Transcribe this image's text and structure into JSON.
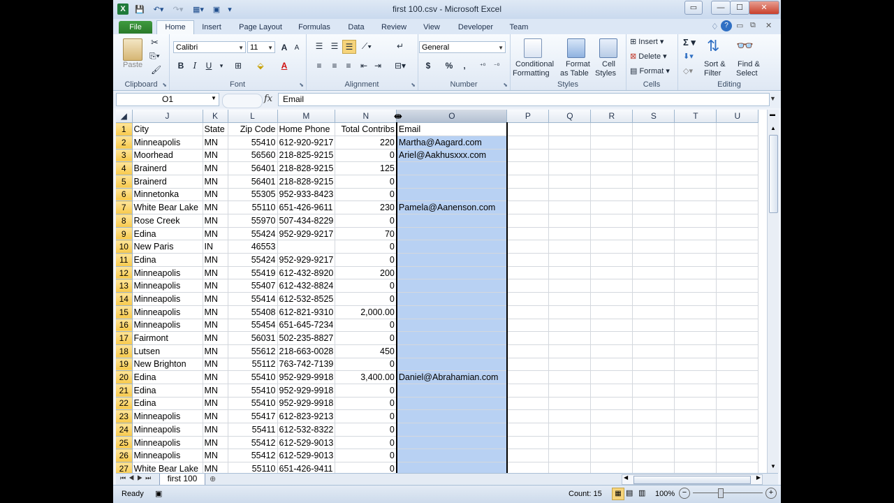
{
  "window": {
    "title": "first 100.csv  -  Microsoft Excel",
    "help_icon": "?",
    "qat": {
      "save": "save-icon",
      "undo": "undo-icon",
      "redo": "redo-icon",
      "customize": "customize-qat-icon"
    }
  },
  "tabs": [
    "File",
    "Home",
    "Insert",
    "Page Layout",
    "Formulas",
    "Data",
    "Review",
    "View",
    "Developer",
    "Team"
  ],
  "ribbon": {
    "clipboard": {
      "label": "Clipboard",
      "paste": "Paste"
    },
    "font": {
      "label": "Font",
      "name": "Calibri",
      "size": "11",
      "bold": "B",
      "italic": "I",
      "underline": "U",
      "grow": "A",
      "shrink": "A"
    },
    "alignment": {
      "label": "Alignment"
    },
    "number": {
      "label": "Number",
      "format": "General",
      "currency": "$",
      "percent": "%",
      "comma": ","
    },
    "styles": {
      "label": "Styles",
      "conditional": "Conditional",
      "conditional2": "Formatting",
      "format_table": "Format",
      "format_table2": "as Table",
      "cell_styles": "Cell",
      "cell_styles2": "Styles"
    },
    "cells": {
      "label": "Cells",
      "insert": "Insert",
      "delete": "Delete",
      "format": "Format"
    },
    "editing": {
      "label": "Editing",
      "sort": "Sort &",
      "sort2": "Filter",
      "find": "Find &",
      "find2": "Select",
      "sum": "Σ"
    }
  },
  "formula_bar": {
    "name_box": "O1",
    "fx": "fx",
    "content": "Email"
  },
  "grid": {
    "columns": [
      "J",
      "K",
      "L",
      "M",
      "N",
      "O",
      "P",
      "Q",
      "R",
      "S",
      "T",
      "U"
    ],
    "rows": [
      {
        "n": "1",
        "city": "City",
        "state": "State",
        "zip": "Zip Code",
        "phone": "Home Phone",
        "contrib": "Total Contribs",
        "email": "Email"
      },
      {
        "n": "2",
        "city": "Minneapolis",
        "state": "MN",
        "zip": "55410",
        "phone": "612-920-9217",
        "contrib": "220",
        "email": "Martha@Aagard.com"
      },
      {
        "n": "3",
        "city": "Moorhead",
        "state": "MN",
        "zip": "56560",
        "phone": "218-825-9215",
        "contrib": "0",
        "email": "Ariel@Aakhusxxx.com"
      },
      {
        "n": "4",
        "city": "Brainerd",
        "state": "MN",
        "zip": "56401",
        "phone": "218-828-9215",
        "contrib": "125",
        "email": ""
      },
      {
        "n": "5",
        "city": "Brainerd",
        "state": "MN",
        "zip": "56401",
        "phone": "218-828-9215",
        "contrib": "0",
        "email": ""
      },
      {
        "n": "6",
        "city": "Minnetonka",
        "state": "MN",
        "zip": "55305",
        "phone": "952-933-8423",
        "contrib": "0",
        "email": ""
      },
      {
        "n": "7",
        "city": "White Bear Lake",
        "state": "MN",
        "zip": "55110",
        "phone": "651-426-9611",
        "contrib": "230",
        "email": "Pamela@Aanenson.com"
      },
      {
        "n": "8",
        "city": "Rose Creek",
        "state": "MN",
        "zip": "55970",
        "phone": "507-434-8229",
        "contrib": "0",
        "email": ""
      },
      {
        "n": "9",
        "city": "Edina",
        "state": "MN",
        "zip": "55424",
        "phone": "952-929-9217",
        "contrib": "70",
        "email": ""
      },
      {
        "n": "10",
        "city": "New Paris",
        "state": "IN",
        "zip": "46553",
        "phone": "",
        "contrib": "0",
        "email": ""
      },
      {
        "n": "11",
        "city": "Edina",
        "state": "MN",
        "zip": "55424",
        "phone": "952-929-9217",
        "contrib": "0",
        "email": ""
      },
      {
        "n": "12",
        "city": "Minneapolis",
        "state": "MN",
        "zip": "55419",
        "phone": "612-432-8920",
        "contrib": "200",
        "email": ""
      },
      {
        "n": "13",
        "city": "Minneapolis",
        "state": "MN",
        "zip": "55407",
        "phone": "612-432-8824",
        "contrib": "0",
        "email": ""
      },
      {
        "n": "14",
        "city": "Minneapolis",
        "state": "MN",
        "zip": "55414",
        "phone": "612-532-8525",
        "contrib": "0",
        "email": ""
      },
      {
        "n": "15",
        "city": "Minneapolis",
        "state": "MN",
        "zip": "55408",
        "phone": "612-821-9310",
        "contrib": "2,000.00",
        "email": ""
      },
      {
        "n": "16",
        "city": "Minneapolis",
        "state": "MN",
        "zip": "55454",
        "phone": "651-645-7234",
        "contrib": "0",
        "email": ""
      },
      {
        "n": "17",
        "city": "Fairmont",
        "state": "MN",
        "zip": "56031",
        "phone": "502-235-8827",
        "contrib": "0",
        "email": ""
      },
      {
        "n": "18",
        "city": "Lutsen",
        "state": "MN",
        "zip": "55612",
        "phone": "218-663-0028",
        "contrib": "450",
        "email": ""
      },
      {
        "n": "19",
        "city": "New Brighton",
        "state": "MN",
        "zip": "55112",
        "phone": "763-742-7139",
        "contrib": "0",
        "email": ""
      },
      {
        "n": "20",
        "city": "Edina",
        "state": "MN",
        "zip": "55410",
        "phone": "952-929-9918",
        "contrib": "3,400.00",
        "email": "Daniel@Abrahamian.com"
      },
      {
        "n": "21",
        "city": "Edina",
        "state": "MN",
        "zip": "55410",
        "phone": "952-929-9918",
        "contrib": "0",
        "email": ""
      },
      {
        "n": "22",
        "city": "Edina",
        "state": "MN",
        "zip": "55410",
        "phone": "952-929-9918",
        "contrib": "0",
        "email": ""
      },
      {
        "n": "23",
        "city": "Minneapolis",
        "state": "MN",
        "zip": "55417",
        "phone": "612-823-9213",
        "contrib": "0",
        "email": ""
      },
      {
        "n": "24",
        "city": "Minneapolis",
        "state": "MN",
        "zip": "55411",
        "phone": "612-532-8322",
        "contrib": "0",
        "email": ""
      },
      {
        "n": "25",
        "city": "Minneapolis",
        "state": "MN",
        "zip": "55412",
        "phone": "612-529-9013",
        "contrib": "0",
        "email": ""
      },
      {
        "n": "26",
        "city": "Minneapolis",
        "state": "MN",
        "zip": "55412",
        "phone": "612-529-9013",
        "contrib": "0",
        "email": ""
      },
      {
        "n": "27",
        "city": "White Bear Lake",
        "state": "MN",
        "zip": "55110",
        "phone": "651-426-9411",
        "contrib": "0",
        "email": ""
      }
    ]
  },
  "sheet_tabs": {
    "active": "first 100"
  },
  "status_bar": {
    "mode": "Ready",
    "count": "Count: 15",
    "zoom": "100%",
    "zoom_out": "−",
    "zoom_in": "+"
  },
  "colors": {
    "accent": "#2a7a2a",
    "selection": "#b8d1f3",
    "header_highlight": "#f7c94b"
  }
}
